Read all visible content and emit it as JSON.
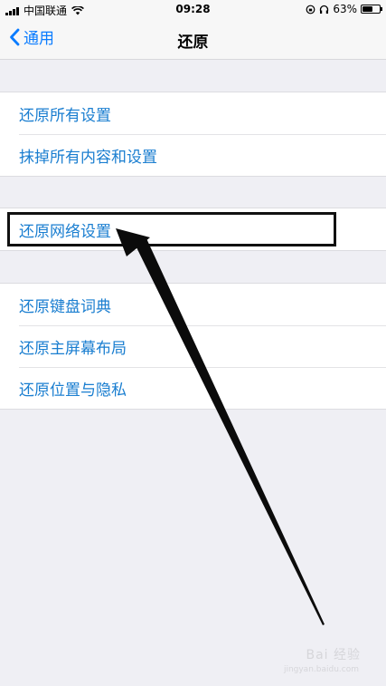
{
  "status_bar": {
    "carrier": "中国联通",
    "time": "09:28",
    "battery_percent": "63%",
    "battery_level": 0.63
  },
  "nav": {
    "back_label": "通用",
    "title": "还原"
  },
  "groups": [
    {
      "items": [
        "还原所有设置",
        "抹掉所有内容和设置"
      ]
    },
    {
      "items": [
        "还原网络设置"
      ]
    },
    {
      "items": [
        "还原键盘词典",
        "还原主屏幕布局",
        "还原位置与隐私"
      ]
    }
  ],
  "watermark": {
    "brand": "Bai 经验",
    "url": "jingyan.baidu.com"
  },
  "colors": {
    "link_blue": "#1a7ed0",
    "nav_blue": "#0a7cff",
    "background": "#efeff4"
  }
}
